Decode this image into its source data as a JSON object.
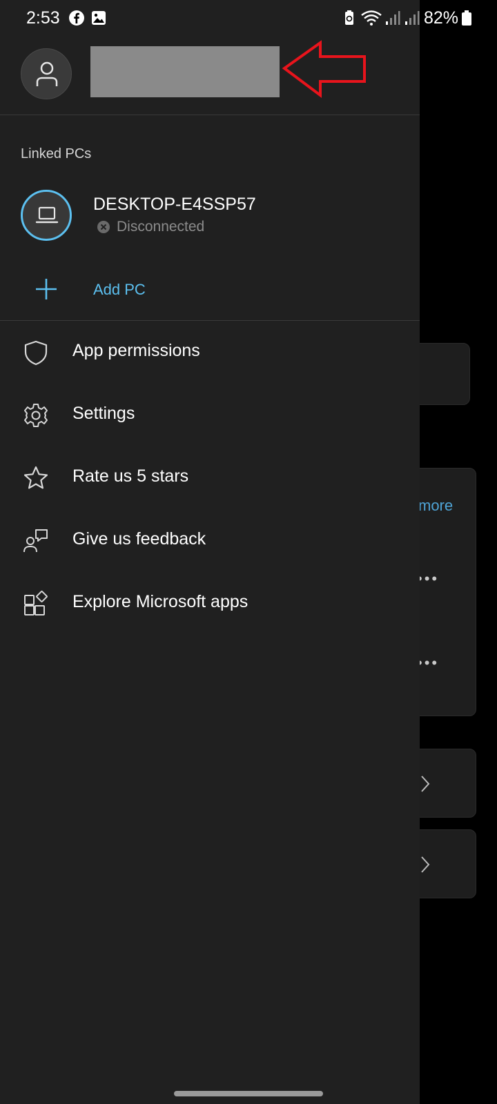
{
  "status_bar": {
    "time": "2:53",
    "battery_percent": "82%",
    "icons": [
      "facebook-icon",
      "gallery-icon",
      "battery-saver-icon",
      "wifi-icon",
      "signal-icon",
      "signal-icon",
      "battery-icon"
    ]
  },
  "drawer": {
    "profile": {
      "avatar_icon": "person-icon",
      "name_redacted": true
    },
    "linked_pcs": {
      "section_label": "Linked PCs",
      "items": [
        {
          "name": "DESKTOP-E4SSP57",
          "status": "Disconnected",
          "icon": "laptop-icon",
          "status_icon": "x-circle-icon"
        }
      ],
      "add_label": "Add PC"
    },
    "menu": [
      {
        "label": "App permissions",
        "icon": "shield-icon"
      },
      {
        "label": "Settings",
        "icon": "gear-icon"
      },
      {
        "label": "Rate us 5 stars",
        "icon": "star-icon"
      },
      {
        "label": "Give us feedback",
        "icon": "feedback-icon"
      },
      {
        "label": "Explore Microsoft apps",
        "icon": "apps-icon"
      }
    ]
  },
  "background": {
    "more_link": "more"
  },
  "colors": {
    "drawer_bg": "#202020",
    "accent": "#5cc0f0",
    "divider": "#3a3a3a",
    "annotation": "#e8141c",
    "muted_text": "#8c8c8c"
  }
}
